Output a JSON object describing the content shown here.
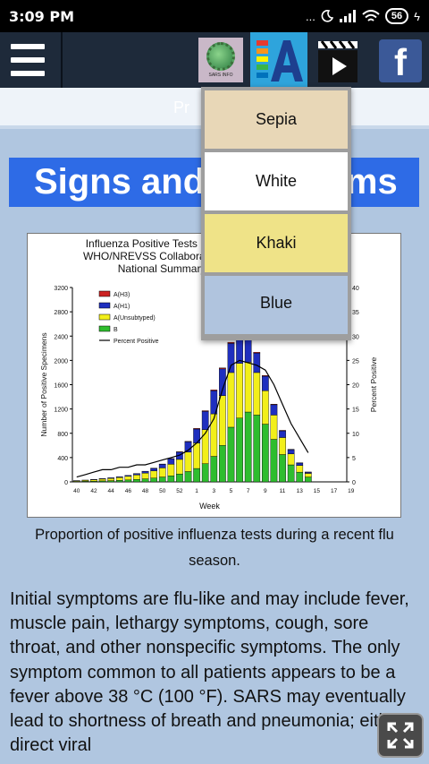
{
  "status_bar": {
    "time": "3:09 PM",
    "battery": "56",
    "signal_text": "...",
    "charging": "ϟ"
  },
  "app_bar": {
    "sars_icon_label": "SARS INFO",
    "fb_label": "f"
  },
  "tab": {
    "label": "Pr"
  },
  "heading": {
    "text": "Signs and Symptoms"
  },
  "dropdown": {
    "items": [
      "Sepia",
      "White",
      "Khaki",
      "Blue"
    ]
  },
  "figure": {
    "caption": "Proportion of positive influenza tests during a recent flu season."
  },
  "chart_data": {
    "type": "bar",
    "title": "Influenza Positive Tests Reported to CDC, WHO/NREVSS Collaborating Laboratories, National Summary, 2008-09",
    "xlabel": "Week",
    "ylabel": "Number of Positive Specimens",
    "ylabel_right": "Percent Positive",
    "ylim": [
      0,
      3200
    ],
    "ylim_right": [
      0,
      40
    ],
    "y_ticks": [
      "0",
      "400",
      "800",
      "1200",
      "1600",
      "2000",
      "2400",
      "2800",
      "3200"
    ],
    "y_ticks_right": [
      "0",
      "5",
      "10",
      "15",
      "20",
      "25",
      "30",
      "35",
      "40"
    ],
    "x_ticks": [
      "40",
      "42",
      "44",
      "46",
      "48",
      "50",
      "52",
      "1",
      "3",
      "5",
      "7",
      "9",
      "11",
      "13",
      "15",
      "17",
      "19"
    ],
    "categories": [
      "40",
      "41",
      "42",
      "43",
      "44",
      "45",
      "46",
      "47",
      "48",
      "49",
      "50",
      "51",
      "52",
      "1",
      "2",
      "3",
      "4",
      "5",
      "6",
      "7",
      "8",
      "9",
      "10",
      "11",
      "12",
      "13",
      "14",
      "15",
      "16",
      "17",
      "18",
      "19"
    ],
    "legend_position": "top-left",
    "series": [
      {
        "name": "A(H3)",
        "color": "#cc2222",
        "values": [
          0,
          0,
          0,
          0,
          0,
          0,
          0,
          1,
          2,
          3,
          4,
          5,
          6,
          8,
          10,
          12,
          14,
          16,
          18,
          18,
          16,
          14,
          12,
          10,
          8,
          6,
          4,
          3,
          0,
          0,
          0,
          0
        ]
      },
      {
        "name": "A(H1)",
        "color": "#1f2fbf",
        "values": [
          3,
          5,
          6,
          8,
          10,
          12,
          15,
          20,
          28,
          40,
          60,
          90,
          120,
          170,
          230,
          300,
          380,
          440,
          480,
          460,
          400,
          320,
          240,
          170,
          110,
          70,
          40,
          20,
          0,
          0,
          0,
          0
        ]
      },
      {
        "name": "A(Unsubtyped)",
        "color": "#f2ef1a",
        "values": [
          10,
          15,
          22,
          30,
          38,
          48,
          60,
          75,
          95,
          120,
          150,
          190,
          240,
          320,
          420,
          560,
          700,
          820,
          900,
          900,
          820,
          700,
          550,
          400,
          280,
          180,
          110,
          60,
          0,
          0,
          0,
          0
        ]
      },
      {
        "name": "B",
        "color": "#2ebd2e",
        "values": [
          8,
          10,
          12,
          16,
          20,
          25,
          32,
          40,
          50,
          62,
          80,
          100,
          130,
          170,
          220,
          300,
          420,
          600,
          900,
          1050,
          1150,
          1100,
          950,
          700,
          450,
          280,
          160,
          80,
          0,
          0,
          0,
          0
        ]
      }
    ],
    "percent_positive": [
      1,
      1.5,
      2,
      2.5,
      2.5,
      3,
      3,
      3.5,
      3.5,
      4,
      4.5,
      5,
      5.5,
      6.5,
      8,
      10,
      13,
      19,
      24,
      25,
      24.5,
      24,
      23,
      20,
      16,
      12,
      9,
      6,
      null,
      null,
      null,
      null
    ],
    "percent_label": "Percent Positive"
  },
  "body": {
    "paragraph": "Initial symptoms are flu-like and may include fever, muscle pain, lethargy symptoms, cough, sore throat, and other nonspecific symptoms. The only symptom common to all patients appears to be a fever above 38 °C (100 °F). SARS may eventually lead to shortness of breath and pneumonia; either direct viral"
  }
}
